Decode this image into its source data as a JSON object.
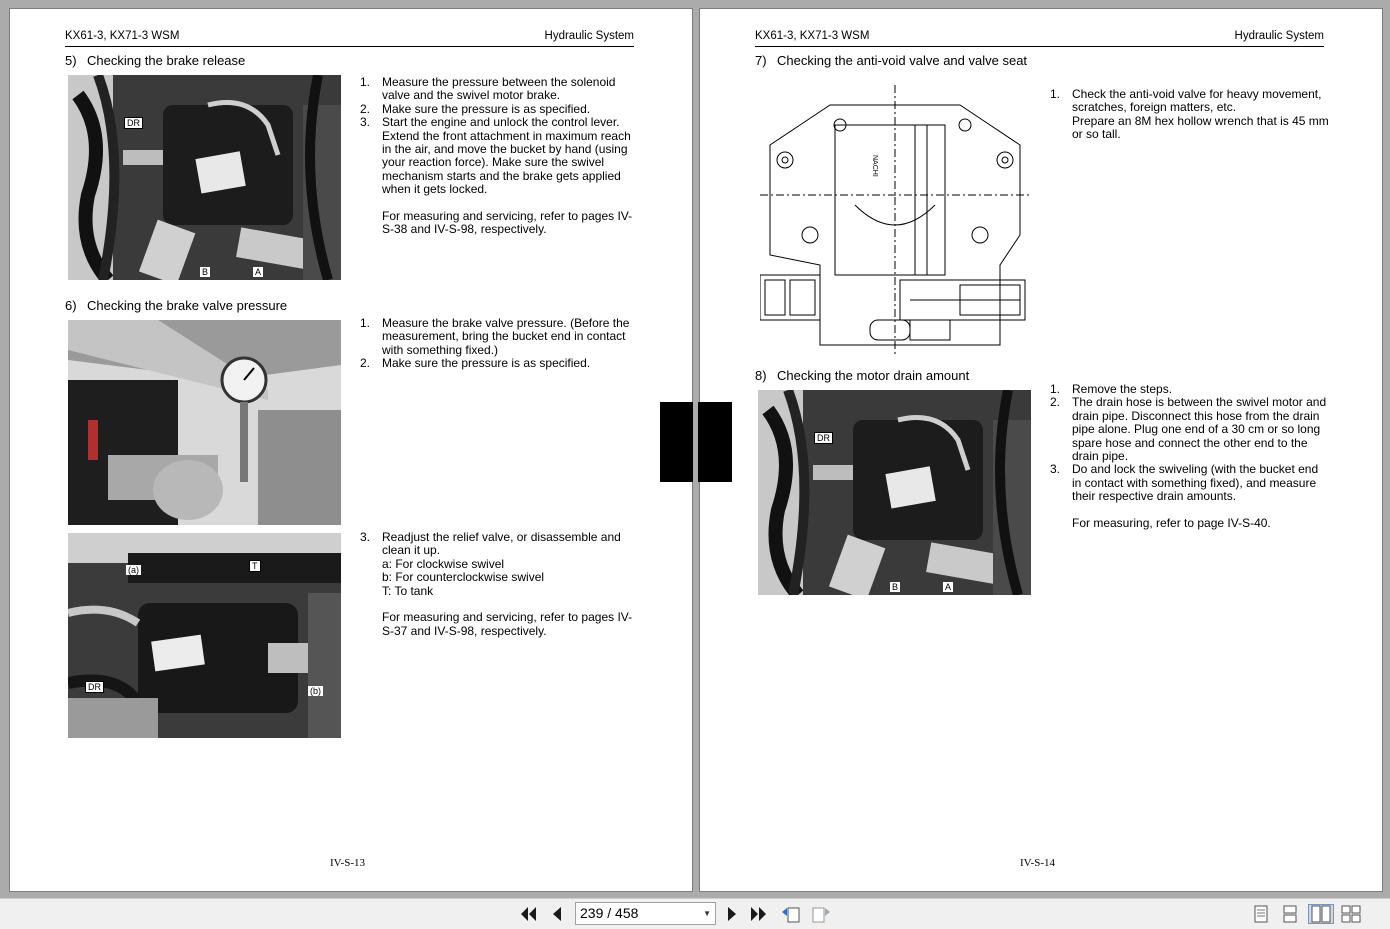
{
  "doc": {
    "header_left": "KX61-3, KX71-3 WSM",
    "header_right": "Hydraulic System"
  },
  "left_page": {
    "page_number": "IV-S-13",
    "sec5": {
      "num": "5)",
      "title": "Checking the brake release",
      "photo_labels": {
        "dr": "DR",
        "b": "B",
        "a": "A"
      },
      "steps": [
        {
          "n": "1.",
          "text": "Measure the pressure between the solenoid valve and the swivel motor brake."
        },
        {
          "n": "2.",
          "text": "Make sure the pressure is as specified."
        },
        {
          "n": "3.",
          "text": "Start the engine and unlock the control lever. Extend the front attachment in maximum reach in the air, and move the bucket by hand (using your reaction force). Make sure the swivel mechanism starts and the brake gets applied when it gets locked."
        }
      ],
      "note": "For measuring and servicing, refer to pages IV-S-38 and IV-S-98, respectively."
    },
    "sec6": {
      "num": "6)",
      "title": "Checking the brake valve pressure",
      "steps": [
        {
          "n": "1.",
          "text": "Measure the brake valve pressure. (Before the measurement, bring the bucket end in contact with something fixed.)"
        },
        {
          "n": "2.",
          "text": "Make sure the pressure is as specified."
        }
      ],
      "step3": {
        "n": "3.",
        "text": "Readjust the relief valve, or disassemble and clean it up."
      },
      "legend": [
        "a: For clockwise swivel",
        "b: For counterclockwise swivel",
        "T: To tank"
      ],
      "note": "For measuring and servicing, refer to pages IV-S-37 and IV-S-98, respectively.",
      "photo2_labels": {
        "a": "(a)",
        "t": "T",
        "dr": "DR",
        "b": "(b)"
      }
    }
  },
  "right_page": {
    "page_number": "IV-S-14",
    "sec7": {
      "num": "7)",
      "title": "Checking the anti-void valve and valve seat",
      "steps": [
        {
          "n": "1.",
          "text": "Check the anti-void valve for heavy movement, scratches, foreign matters, etc."
        }
      ],
      "note": "Prepare an 8M hex hollow wrench that is 45 mm or so tall.",
      "drawing_brand": "NACHI"
    },
    "sec8": {
      "num": "8)",
      "title": "Checking the motor drain amount",
      "photo_labels": {
        "dr": "DR",
        "b": "B",
        "a": "A"
      },
      "steps": [
        {
          "n": "1.",
          "text": "Remove the steps."
        },
        {
          "n": "2.",
          "text": "The drain hose is between the swivel motor and drain pipe. Disconnect this hose from the drain pipe alone. Plug one end of a 30 cm or so long spare hose and connect the other end to the drain pipe."
        },
        {
          "n": "3.",
          "text": "Do and lock the swiveling (with the bucket end in contact with something fixed), and measure their respective drain amounts."
        }
      ],
      "note": "For measuring, refer to page IV-S-40."
    }
  },
  "toolbar": {
    "page_indicator": "239 / 458",
    "icons": [
      "first-page-icon",
      "prev-page-icon",
      "next-page-icon",
      "last-page-icon",
      "go-back-icon",
      "go-forward-icon",
      "single-page-icon",
      "continuous-icon",
      "facing-pages-icon",
      "facing-continuous-icon"
    ]
  }
}
